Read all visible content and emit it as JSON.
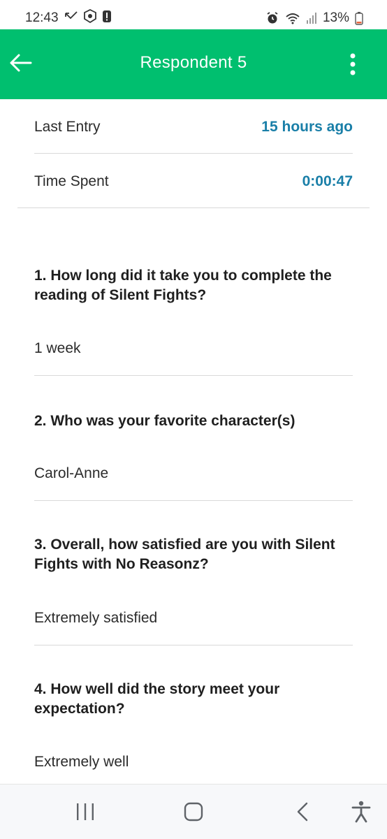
{
  "status_bar": {
    "time": "12:43",
    "battery": "13%"
  },
  "app_bar": {
    "title": "Respondent 5"
  },
  "meta": {
    "last_entry_label": "Last Entry",
    "last_entry_value": "15 hours ago",
    "time_spent_label": "Time Spent",
    "time_spent_value": "0:00:47"
  },
  "questions": [
    {
      "line1": "1. How long did it take you to complete the",
      "line2": "reading of Silent Fights?",
      "answer": "1 week"
    },
    {
      "line1": "2. Who was your favorite character(s)",
      "answer": "Carol-Anne"
    },
    {
      "line1": "3. Overall, how satisfied are you with Silent",
      "line2": "Fights with No Reasonz?",
      "answer": "Extremely satisfied"
    },
    {
      "line1": "4. How well did the story meet your",
      "line2": "expectation?",
      "answer": "Extremely well"
    }
  ],
  "colors": {
    "brand": "#00bf6f",
    "meta_value": "#1a7fa8"
  },
  "icons": {
    "back": "arrow-left-icon",
    "more": "more-vertical-icon",
    "nav_recents": "recent-apps-icon",
    "nav_home": "home-icon",
    "nav_back": "back-chevron-icon",
    "nav_accessibility": "accessibility-icon"
  }
}
